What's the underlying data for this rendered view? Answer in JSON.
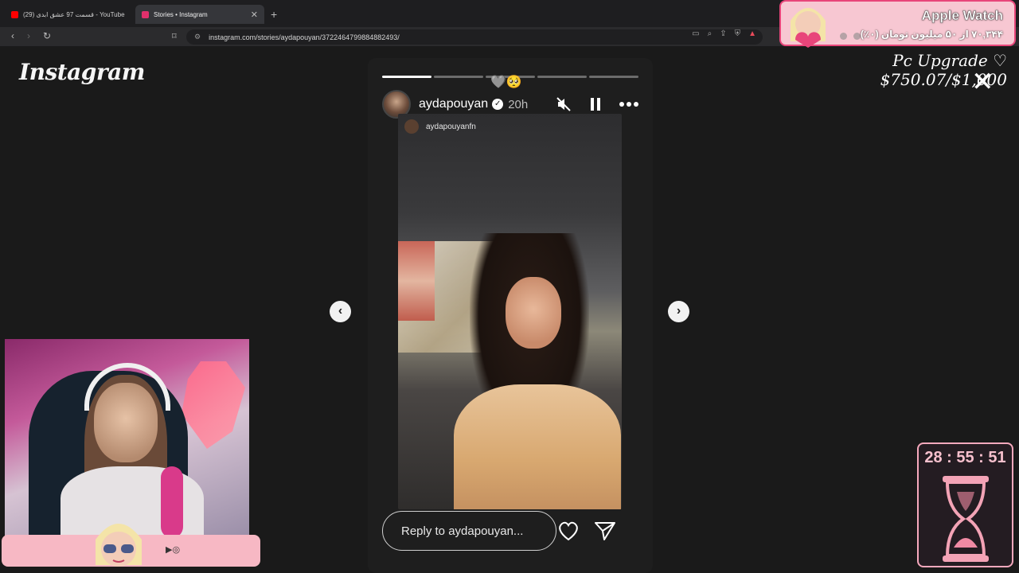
{
  "browser": {
    "tabs": [
      {
        "title": "(29) قسمت 97 عشق ابدی - YouTube",
        "active": false,
        "favicon": "youtube-icon",
        "color": "#ff0000"
      },
      {
        "title": "Stories • Instagram",
        "active": true,
        "favicon": "instagram-icon",
        "color": "#e1306c"
      }
    ],
    "new_tab": "+",
    "close_glyph": "✕",
    "url": "instagram.com/stories/aydapouyan/3722464799884882493/"
  },
  "instagram": {
    "logo": "Instagram",
    "story": {
      "username": "aydapouyan",
      "verified": true,
      "time_ago": "20h",
      "repost_username": "aydapouyanfn",
      "emojis": "🩶🥺",
      "progress_segments": 5,
      "progress_done": 1,
      "reply_placeholder": "Reply to aydapouyan..."
    }
  },
  "overlay": {
    "goal_title": "Apple Watch",
    "goal_progress_text": "۷۰,۳۴۴ از ۵۰ میلیون تومان (۰٪)",
    "pc_upgrade": "Pc Upgrade ♡ $750.07/$1,000",
    "close": "✕",
    "timer": "28 : 55 : 51",
    "accent": "#e8457a"
  }
}
